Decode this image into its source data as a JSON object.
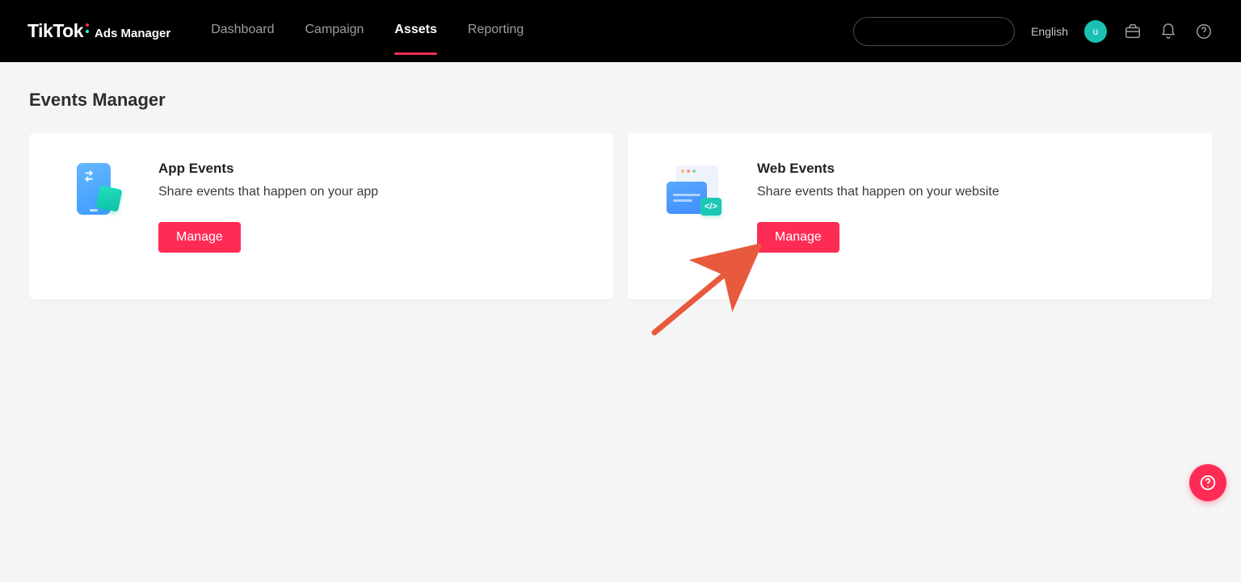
{
  "brand": {
    "logo": "TikTok",
    "product": "Ads Manager"
  },
  "nav": {
    "items": [
      {
        "label": "Dashboard",
        "active": false
      },
      {
        "label": "Campaign",
        "active": false
      },
      {
        "label": "Assets",
        "active": true
      },
      {
        "label": "Reporting",
        "active": false
      }
    ],
    "language": "English",
    "avatar_letter": "u"
  },
  "page": {
    "title": "Events Manager",
    "cards": [
      {
        "key": "app",
        "title": "App Events",
        "description": "Share events that happen on your app",
        "button_label": "Manage"
      },
      {
        "key": "web",
        "title": "Web Events",
        "description": "Share events that happen on your website",
        "button_label": "Manage"
      }
    ]
  },
  "annotation": {
    "arrow_color": "#e85a3e",
    "points_to": "web-events-manage-button"
  },
  "colors": {
    "primary": "#fe2c55",
    "teal": "#1bc0b4"
  }
}
